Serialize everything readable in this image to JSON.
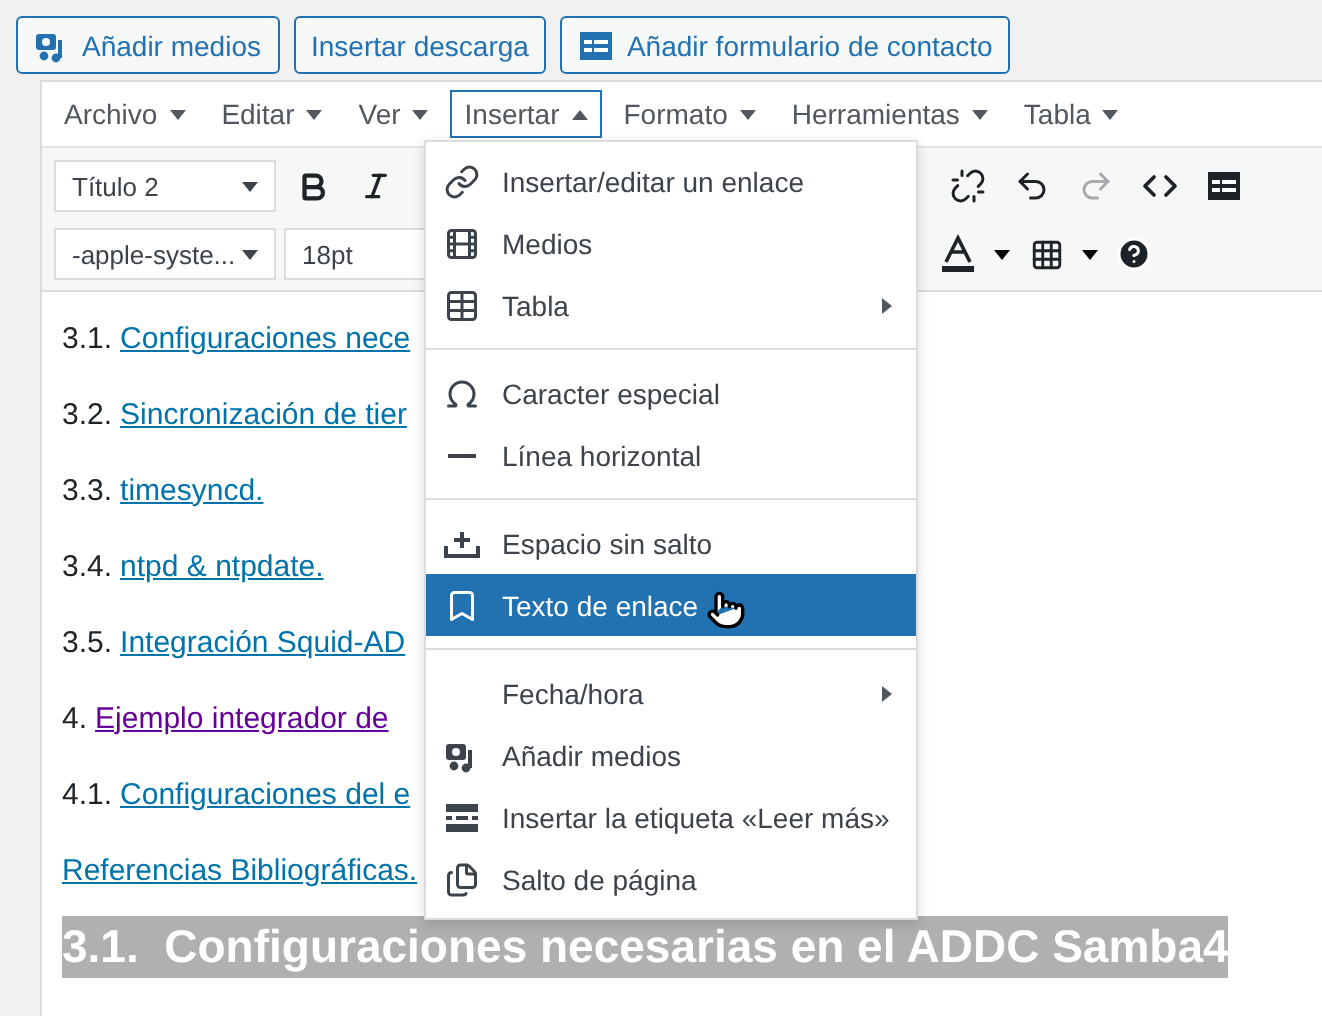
{
  "media_buttons": [
    "Añadir medios",
    "Insertar descarga",
    "Añadir formulario de contacto"
  ],
  "menubar": [
    {
      "label": "Archivo",
      "selected": false
    },
    {
      "label": "Editar",
      "selected": false
    },
    {
      "label": "Ver",
      "selected": false
    },
    {
      "label": "Insertar",
      "selected": true
    },
    {
      "label": "Formato",
      "selected": false
    },
    {
      "label": "Herramientas",
      "selected": false
    },
    {
      "label": "Tabla",
      "selected": false
    }
  ],
  "toolbar": {
    "format_select": "Título 2",
    "font_select": "-apple-syste...",
    "size_select": "18pt"
  },
  "insert_menu": [
    [
      {
        "label": "Insertar/editar un enlace",
        "submenu": false,
        "selected": false
      },
      {
        "label": "Medios",
        "submenu": false,
        "selected": false
      },
      {
        "label": "Tabla",
        "submenu": true,
        "selected": false
      }
    ],
    [
      {
        "label": "Caracter especial",
        "submenu": false,
        "selected": false
      },
      {
        "label": "Línea horizontal",
        "submenu": false,
        "selected": false
      }
    ],
    [
      {
        "label": "Espacio sin salto",
        "submenu": false,
        "selected": false
      },
      {
        "label": "Texto de enlace",
        "submenu": false,
        "selected": true
      }
    ],
    [
      {
        "label": "Fecha/hora",
        "submenu": true,
        "selected": false
      },
      {
        "label": "Añadir medios",
        "submenu": false,
        "selected": false
      },
      {
        "label": "Insertar la etiqueta «Leer más»",
        "submenu": false,
        "selected": false
      },
      {
        "label": "Salto de página",
        "submenu": false,
        "selected": false
      }
    ]
  ],
  "content": [
    {
      "number": "3.1.",
      "link": "Configuraciones nece",
      "visited": false
    },
    {
      "number": "3.2.",
      "link": "Sincronización de tier",
      "visited": false
    },
    {
      "number": "3.3.",
      "link": "timesyncd.",
      "visited": false
    },
    {
      "number": "3.4.",
      "link": "ntpd & ntpdate.",
      "visited": false
    },
    {
      "number": "3.5.",
      "link": "Integración Squid-AD",
      "visited": false
    },
    {
      "number": "4.",
      "link": "Ejemplo integrador de",
      "visited": true
    },
    {
      "number": "4.1.",
      "link": "Configuraciones del e",
      "visited": false
    },
    {
      "link": "Referencias Bibliográficas.",
      "visited": false
    }
  ],
  "heading": "3.1.  Configuraciones necesarias en el ADDC Samba4"
}
